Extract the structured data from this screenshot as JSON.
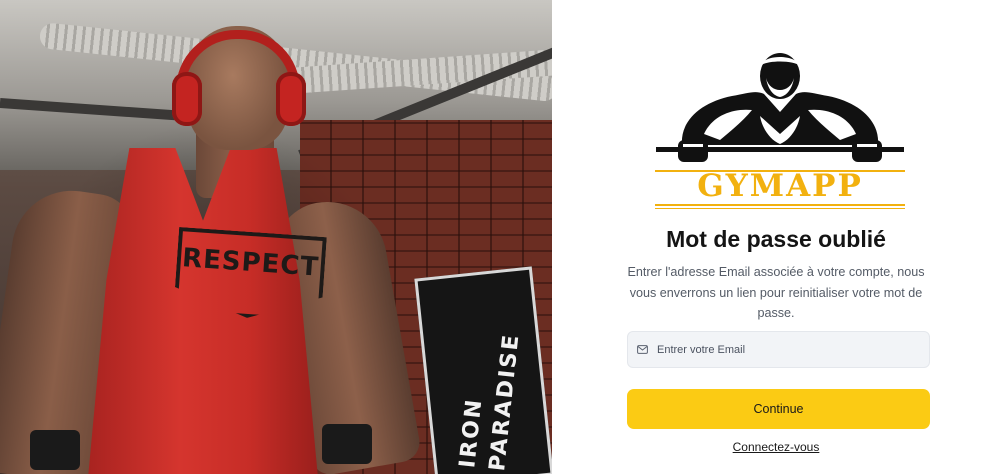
{
  "hero": {
    "banner_text": "IRON PARADISE",
    "shirt_text": "RESPECT"
  },
  "logo": {
    "brand": "GYMAPP",
    "icon": "bodybuilder-logo-icon"
  },
  "form": {
    "title": "Mot de passe oublié",
    "description": "Entrer l'adresse Email associée à votre compte, nous vous enverrons un lien pour reinitialiser votre mot de passe.",
    "email_placeholder": "Entrer votre Email",
    "email_icon": "mail-icon",
    "submit_label": "Continue",
    "login_link": "Connectez-vous"
  },
  "colors": {
    "brand_yellow": "#f2b10f",
    "button_yellow": "#fbcb14",
    "title_text": "#141414",
    "body_text": "#545b66",
    "input_bg": "#f2f4f7"
  }
}
